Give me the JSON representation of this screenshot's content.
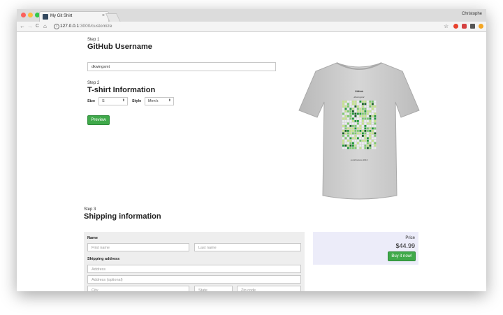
{
  "browser": {
    "tab_title": "My Git Shirt",
    "tab_close": "×",
    "profile_name": "Christophe",
    "url_host": "127.0.0.1",
    "url_path": ":3000/customize",
    "nav_back": "←",
    "nav_forward": "→",
    "nav_reload": "C",
    "nav_home": "⌂",
    "star": "☆"
  },
  "step1": {
    "step_label": "Step 1",
    "heading": "GitHub Username",
    "username_value": "dkwingsmt"
  },
  "step2": {
    "step_label": "Step 2",
    "heading": "T-shirt Information",
    "size_label": "Size",
    "size_value": "S",
    "style_label": "Style",
    "style_value": "Men's",
    "preview_label": "Preview"
  },
  "shirt": {
    "caption_title": "GitHub",
    "caption_user": "dkwingsmt",
    "caption_footer": "contributions 2016",
    "colors": [
      "#ebedf0",
      "#c6e48b",
      "#7bc96f",
      "#239a3b",
      "#196127"
    ]
  },
  "step3": {
    "step_label": "Step 3",
    "heading": "Shipping information",
    "name_label": "Name",
    "first_name_placeholder": "First name",
    "last_name_placeholder": "Last name",
    "address_label": "Shipping address",
    "address_placeholder": "Address",
    "address2_placeholder": "Address (optional)",
    "city_placeholder": "City",
    "state_placeholder": "State",
    "zip_placeholder": "Zip code"
  },
  "price": {
    "label": "Price",
    "value": "$44.99",
    "buy_label": "Buy it now!"
  },
  "colors": {
    "accent_green": "#3fa94a",
    "price_panel_bg": "#ececf9",
    "form_panel_bg": "#eeeeee"
  }
}
